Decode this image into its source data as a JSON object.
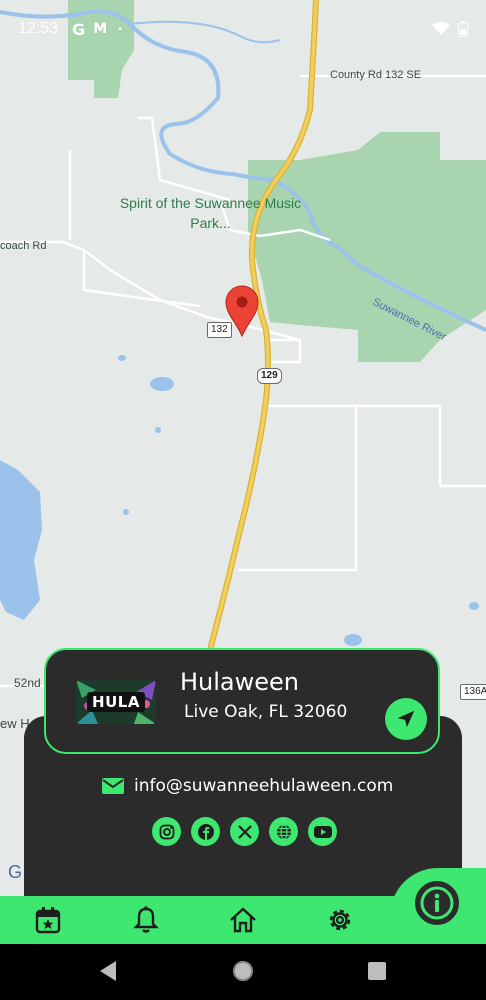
{
  "status_bar": {
    "time": "12:53",
    "notif_g": "G",
    "notif_m": "M",
    "notif_dot": "•"
  },
  "map": {
    "county_road": "County Rd 132 SE",
    "park_label": "Spirit of the Suwannee Music Park...",
    "coach_road": "coach Rd",
    "river_label": "Suwannee River",
    "route_132": "132",
    "route_129": "129",
    "road_52": "52nd",
    "partial_left": "ew H",
    "route_136": "136A",
    "google_g": "G"
  },
  "venue_card": {
    "logo_text": "HULA",
    "name": "Hulaween",
    "address": "Live Oak, FL 32060"
  },
  "contact": {
    "email": "info@suwanneehulaween.com"
  },
  "socials": [
    {
      "icon": "instagram-icon"
    },
    {
      "icon": "facebook-icon"
    },
    {
      "icon": "x-icon"
    },
    {
      "icon": "globe-icon"
    },
    {
      "icon": "youtube-icon"
    }
  ],
  "bottom_nav": {
    "items": [
      "calendar-star-icon",
      "bell-icon",
      "home-icon",
      "gear-icon"
    ],
    "info": "info-icon"
  },
  "colors": {
    "accent": "#3ee870",
    "card": "#2b2b2b",
    "map_bg": "#e5e9e7",
    "park": "#a8d5b0",
    "water": "#9ac2ea",
    "highway": "#f3cf57",
    "pin": "#ea4335"
  }
}
